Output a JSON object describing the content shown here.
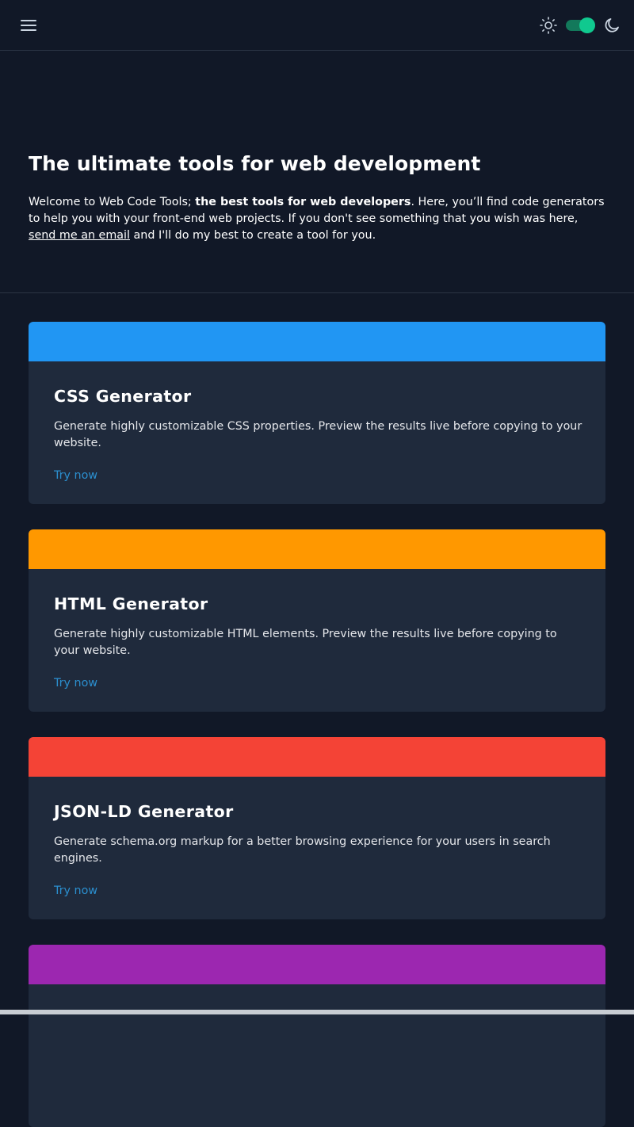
{
  "header": {
    "menu_icon": "hamburger-menu-icon",
    "light_icon": "sun-icon",
    "dark_icon": "moon-icon",
    "theme_toggle_state": "dark",
    "accent": "#10c98f"
  },
  "hero": {
    "title": "The ultimate tools for web development",
    "intro_prefix": "Welcome to Web Code Tools; ",
    "intro_bold": "the best tools for web developers",
    "intro_middle": ". Here, you’ll find code generators to help you with your front-end web projects. If you don't see something that you wish was here, ",
    "intro_link": "send me an email",
    "intro_suffix": " and I'll do my best to create a tool for you."
  },
  "cards": [
    {
      "title": "CSS Generator",
      "description": "Generate highly customizable CSS properties. Preview the results live before copying to your website.",
      "link": "Try now",
      "color": "#2196f3"
    },
    {
      "title": "HTML Generator",
      "description": "Generate highly customizable HTML elements. Preview the results live before copying to your website.",
      "link": "Try now",
      "color": "#ff9800"
    },
    {
      "title": "JSON-LD Generator",
      "description": "Generate schema.org markup for a better browsing experience for your users in search engines.",
      "link": "Try now",
      "color": "#f44336"
    },
    {
      "title": "",
      "description": "",
      "link": "",
      "color": "#9c27b0"
    }
  ]
}
